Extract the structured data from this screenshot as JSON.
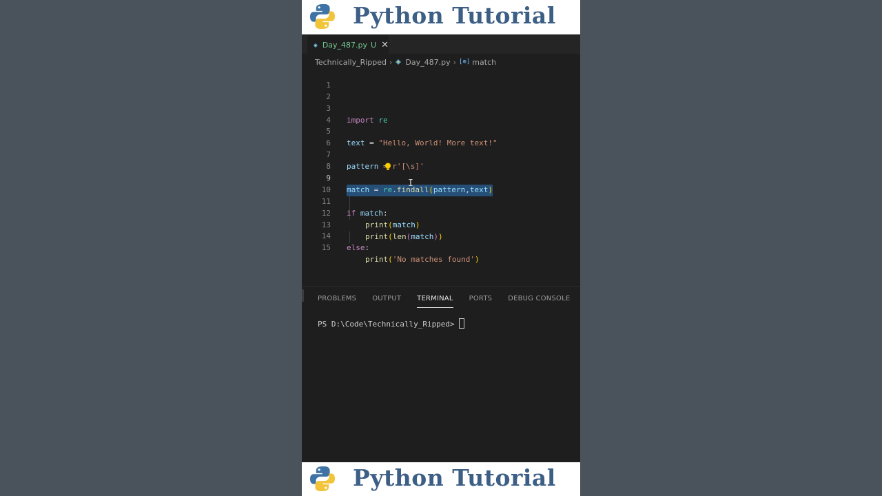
{
  "banner": {
    "title": "Python Tutorial"
  },
  "editor": {
    "tab": {
      "filename": "Day_487.py",
      "status": "U",
      "close_glyph": "✕"
    },
    "breadcrumb": {
      "folder": "Technically_Ripped",
      "file": "Day_487.py",
      "symbol_icon": "[⊕]",
      "symbol": "match",
      "separator": "›"
    },
    "code_lines": [
      {
        "n": "1"
      },
      {
        "n": "2"
      },
      {
        "n": "3"
      },
      {
        "n": "4"
      },
      {
        "n": "5"
      },
      {
        "n": "6"
      },
      {
        "n": "7"
      },
      {
        "n": "8"
      },
      {
        "n": "9"
      },
      {
        "n": "10"
      },
      {
        "n": "11"
      },
      {
        "n": "12"
      },
      {
        "n": "13"
      },
      {
        "n": "14"
      },
      {
        "n": "15"
      }
    ],
    "code": {
      "import_kw": "import",
      "re": "re",
      "text_var": "text",
      "eq": " = ",
      "text_str": "\"Hello, World! More text!\"",
      "pattern_var": "pattern",
      "pattern_str": "r'[\\s]'",
      "match_var": "match",
      "findall": "findall",
      "dot": ".",
      "args_pattern": "pattern",
      "comma": ",",
      "args_text": "text",
      "if_kw": "if",
      "colon": ":",
      "print": "print",
      "len": "len",
      "else_kw": "else",
      "no_match_str": "'No matches found'",
      "lp": "(",
      "rp": ")"
    },
    "active_line": "9"
  },
  "panel": {
    "tabs": [
      "PROBLEMS",
      "OUTPUT",
      "TERMINAL",
      "PORTS",
      "DEBUG CONSOLE"
    ],
    "active_tab": "TERMINAL",
    "prompt": "PS D:\\Code\\Technically_Ripped>"
  },
  "colors": {
    "accent_title": "#3d5f86",
    "editor_bg": "#1e1e1e",
    "selection": "#264f78",
    "tab_modified": "#73c991"
  },
  "icons": [
    "python-logo-icon",
    "python-file-icon",
    "symbol-variable-icon",
    "lightbulb-icon",
    "close-icon",
    "chevron-right-icon"
  ]
}
